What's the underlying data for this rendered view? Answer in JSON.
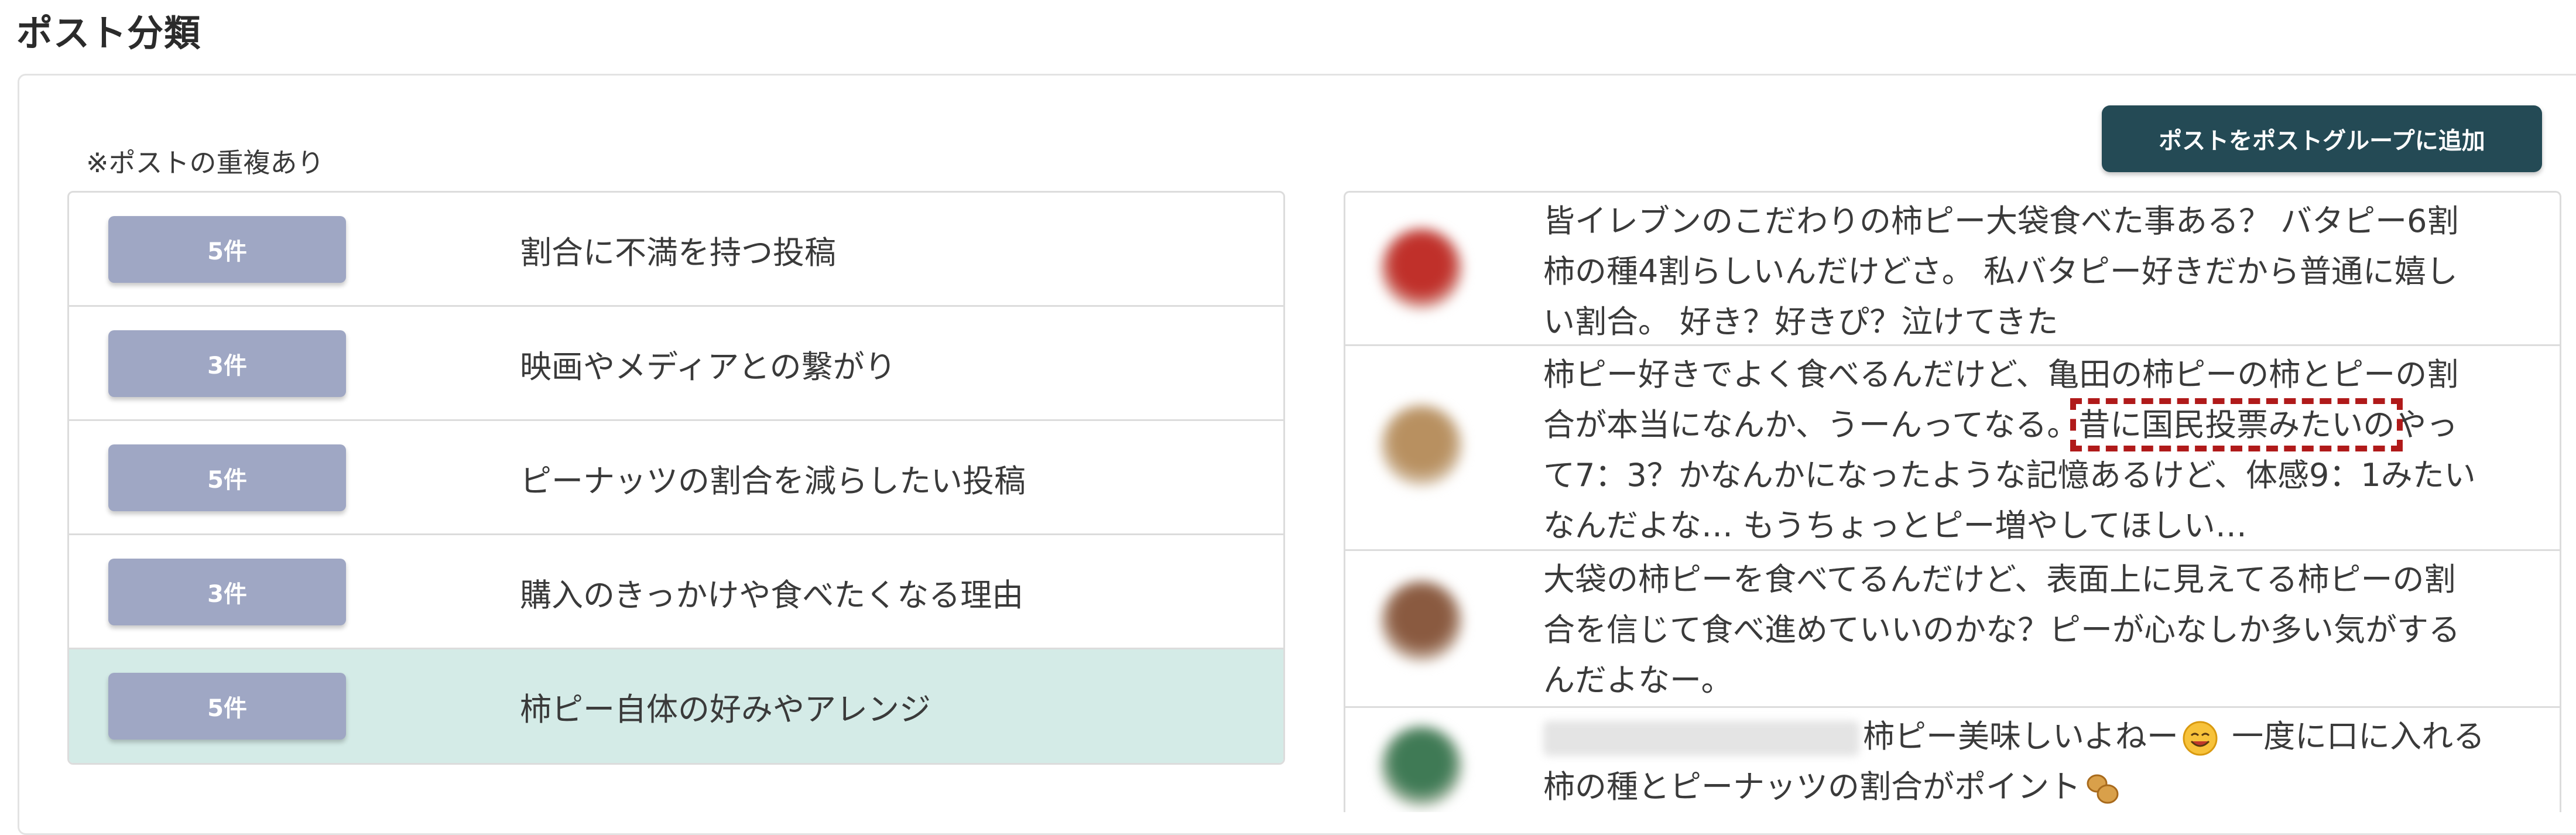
{
  "page": {
    "title": "ポスト分類"
  },
  "panel": {
    "note": "※ポストの重複あり",
    "add_button_label": "ポストをポストグループに追加"
  },
  "categories": [
    {
      "count": "5件",
      "label": "割合に不満を持つ投稿"
    },
    {
      "count": "3件",
      "label": "映画やメディアとの繋がり"
    },
    {
      "count": "5件",
      "label": "ピーナッツの割合を減らしたい投稿"
    },
    {
      "count": "3件",
      "label": "購入のきっかけや食べたくなる理由"
    },
    {
      "count": "5件",
      "label": "柿ピー自体の好みやアレンジ"
    }
  ],
  "selected_category_index": 4,
  "posts": [
    {
      "avatar_color": "#c0302a",
      "text": "皆イレブンのこだわりの柿ピー大袋食べた事ある？ バタピー6割\n柿の種4割らしいんだけどさ。 私バタピー好きだから普通に嬉し\nい割合。 好き？好きぴ？泣けてきた"
    },
    {
      "avatar_color": "#b89060",
      "text_before": "柿ピー好きでよく食べるんだけど、亀田の柿ピーの柿とピーの割\n合が本当になんか、うーんってなる。",
      "text_highlight": "昔に国民投票みたいの",
      "text_after": "やっ\nて7：3？かなんかになったような記憶あるけど、体感9：1みたい\nなんだよな… もうちょっとピー増やしてほしい…"
    },
    {
      "avatar_color": "#8a5a40",
      "text": "大袋の柿ピーを食べてるんだけど、表面上に見えてる柿ピーの割\n合を信じて食べ進めていいのかな？ピーが心なしか多い気がする\nんだよなー。"
    },
    {
      "avatar_color": "#3f7a55",
      "text_first": "柿ピー美味しいよねー",
      "text_mid": " 一度に口に入れる\n柿の種とピーナッツの割合がポイント",
      "icons": [
        "smiling-face-emoji-icon",
        "peanut-emoji-icon"
      ]
    }
  ],
  "colors": {
    "button_bg": "#244a55",
    "badge_bg": "#9fa7c4",
    "selected_row_bg": "#d4ebe7",
    "highlight_border": "#b01a1a"
  }
}
